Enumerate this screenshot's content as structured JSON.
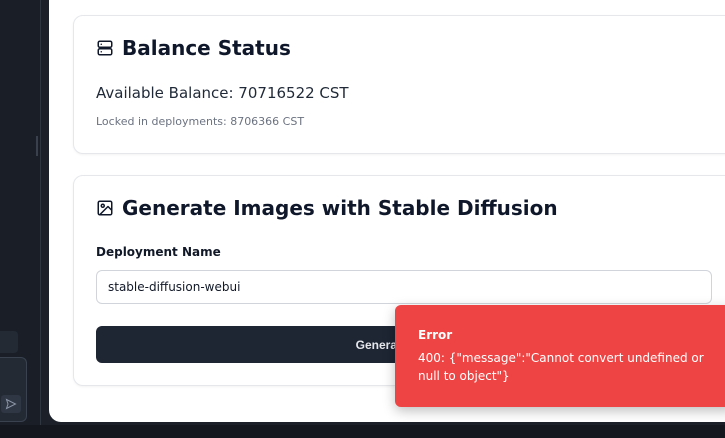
{
  "balance_card": {
    "title": "Balance Status",
    "icon": "server-icon",
    "available_balance": "Available Balance: 70716522 CST",
    "locked": "Locked in deployments: 8706366 CST"
  },
  "generate_card": {
    "title": "Generate Images with Stable Diffusion",
    "icon": "image-icon",
    "field_label": "Deployment Name",
    "field_value": "stable-diffusion-webui",
    "button_label": "Generate Images"
  },
  "toast": {
    "title": "Error",
    "message": "400: {\"message\":\"Cannot convert undefined or null to object\"}",
    "color": "#ef4444"
  },
  "left_pane": {
    "send_icon": "send-icon"
  }
}
